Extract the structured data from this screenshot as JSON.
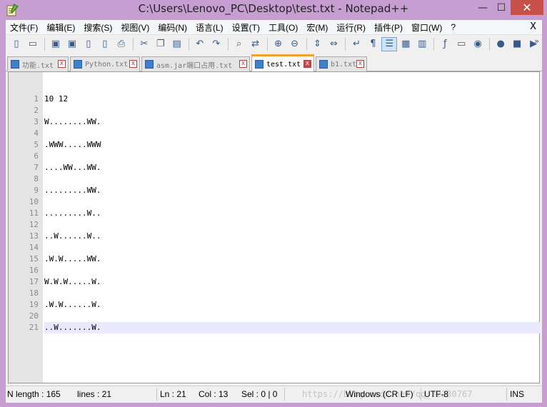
{
  "window": {
    "title": "C:\\Users\\Lenovo_PC\\Desktop\\test.txt - Notepad++",
    "minimize": "—",
    "maximize": "☐",
    "close": "✕"
  },
  "menu": {
    "items": [
      "文件(F)",
      "编辑(E)",
      "搜索(S)",
      "视图(V)",
      "编码(N)",
      "语言(L)",
      "设置(T)",
      "工具(O)",
      "宏(M)",
      "运行(R)",
      "插件(P)",
      "窗口(W)",
      "?"
    ],
    "close": "X"
  },
  "toolbar": {
    "more": "»",
    "buttons": [
      {
        "name": "new-file-icon",
        "glyph": "▯"
      },
      {
        "name": "open-file-icon",
        "glyph": "▭"
      },
      {
        "name": "save-icon",
        "glyph": "▣"
      },
      {
        "name": "save-all-icon",
        "glyph": "▣"
      },
      {
        "name": "close-file-icon",
        "glyph": "▯"
      },
      {
        "name": "close-all-icon",
        "glyph": "▯"
      },
      {
        "name": "print-icon",
        "glyph": "⎙"
      },
      {
        "name": "cut-icon",
        "glyph": "✂"
      },
      {
        "name": "copy-icon",
        "glyph": "❐"
      },
      {
        "name": "paste-icon",
        "glyph": "▤"
      },
      {
        "name": "undo-icon",
        "glyph": "↶"
      },
      {
        "name": "redo-icon",
        "glyph": "↷"
      },
      {
        "name": "find-icon",
        "glyph": "⌕"
      },
      {
        "name": "replace-icon",
        "glyph": "⇄"
      },
      {
        "name": "zoom-in-icon",
        "glyph": "⊕"
      },
      {
        "name": "zoom-out-icon",
        "glyph": "⊖"
      },
      {
        "name": "sync-vertical-icon",
        "glyph": "⇕"
      },
      {
        "name": "sync-horizontal-icon",
        "glyph": "⇔"
      },
      {
        "name": "word-wrap-icon",
        "glyph": "↵"
      },
      {
        "name": "show-all-chars-icon",
        "glyph": "¶"
      },
      {
        "name": "indent-guide-icon",
        "glyph": "☰"
      },
      {
        "name": "doc-map-icon",
        "glyph": "▦"
      },
      {
        "name": "function-list-icon",
        "glyph": "▥"
      },
      {
        "name": "folder-workspace-icon",
        "glyph": "ƒ"
      },
      {
        "name": "folder-icon",
        "glyph": "▭"
      },
      {
        "name": "monitor-icon",
        "glyph": "◉"
      },
      {
        "name": "record-macro-icon",
        "glyph": "●"
      },
      {
        "name": "stop-macro-icon",
        "glyph": "■"
      },
      {
        "name": "play-macro-icon",
        "glyph": "▶"
      }
    ]
  },
  "tabs": [
    {
      "label": "功能.txt",
      "active": false
    },
    {
      "label": "Python.txt",
      "active": false
    },
    {
      "label": "asm.jar端口占用.txt",
      "active": false
    },
    {
      "label": "test.txt",
      "active": true
    },
    {
      "label": "b1.txt",
      "active": false
    }
  ],
  "editor": {
    "current_line": 21,
    "lines": [
      "10 12",
      "",
      "W........WW.",
      "",
      ".WWW.....WWW",
      "",
      "....WW...WW.",
      "",
      ".........WW.",
      "",
      ".........W..",
      "",
      "..W......W..",
      "",
      ".W.W.....WW.",
      "",
      "W.W.W.....W.",
      "",
      ".W.W......W.",
      "",
      "..W.......W."
    ]
  },
  "status": {
    "length": "N length : 165",
    "lines": "lines : 21",
    "ln": "Ln : 21",
    "col": "Col : 13",
    "sel": "Sel : 0 | 0",
    "eol": "Windows (CR LF)",
    "encoding": "UTF-8",
    "mode": "INS",
    "watermark": "https://blog.csdn.net/qq_32230767"
  },
  "colors": {
    "titlebar": "#c79ed2",
    "close_button": "#c7504a",
    "active_tab_accent": "#f0a030",
    "current_line": "#e8e8ff"
  }
}
